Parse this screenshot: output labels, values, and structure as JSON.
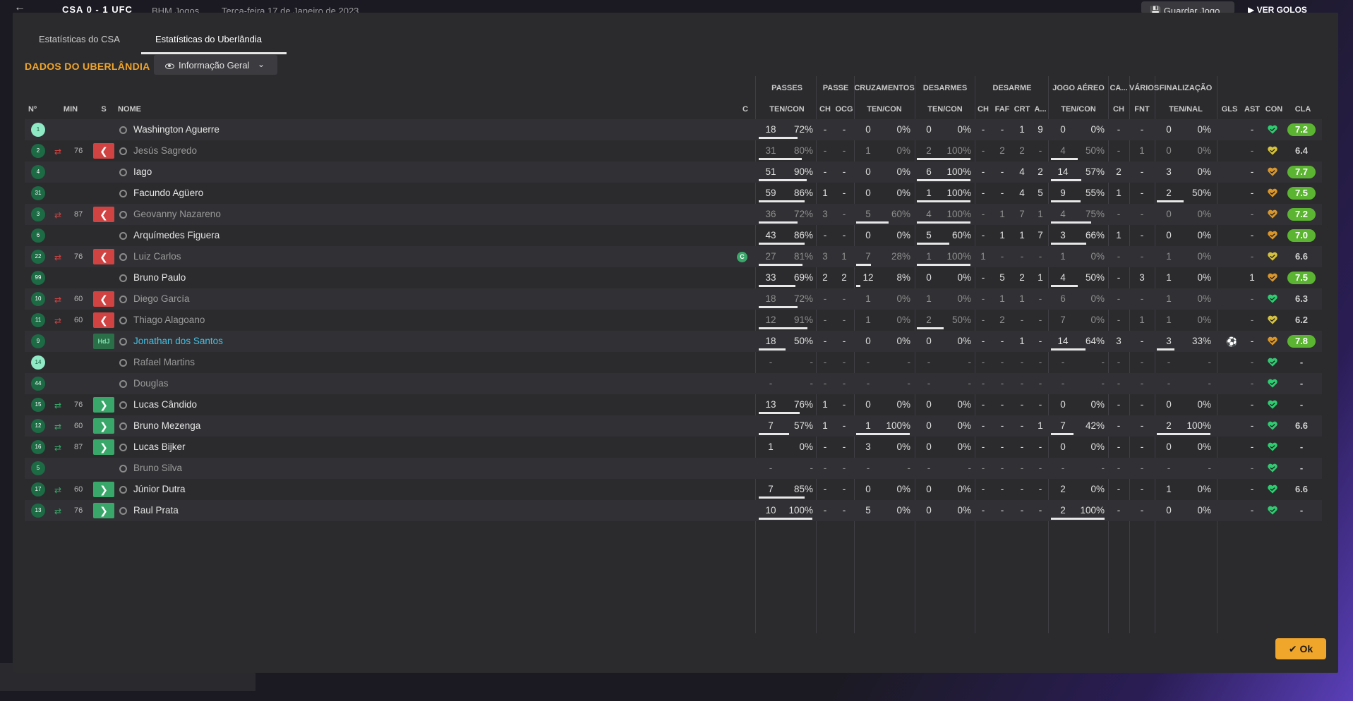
{
  "topbar": {
    "score": "CSA 0 - 1 UFC",
    "meta1": "BHM Jogos",
    "meta2": "Terça-feira 17 de Janeiro de 2023",
    "save": "Guardar Jogo",
    "goals": "VER GOLOS"
  },
  "tabs": {
    "csa": "Estatísticas do CSA",
    "uberlandia": "Estatísticas do Uberlândia"
  },
  "section_title": "DADOS DO UBERLÂNDIA",
  "dropdown": {
    "label": "Informação Geral"
  },
  "groups": {
    "passes": "PASSES",
    "passe": "PASSE",
    "cruzamentos": "CRUZAMENTOS",
    "desarmes": "DESARMES",
    "desarme": "DESARME",
    "jogo_aereo": "JOGO AÉREO",
    "ca": "CA...",
    "varios": "VÁRIOS",
    "finalizacao": "FINALIZAÇÃO"
  },
  "headers": {
    "num": "Nº",
    "min": "MIN",
    "s": "S",
    "nome": "NOME",
    "c": "C",
    "passes_tc": "TEN/CON",
    "passe_ch": "CH",
    "passe_ocg": "OCG",
    "cruz_tc": "TEN/CON",
    "des_tc": "TEN/CON",
    "d_ch": "CH",
    "d_faf": "FAF",
    "d_crt": "CRT",
    "d_a": "A...",
    "ja_tc": "TEN/CON",
    "ca_ch": "CH",
    "v_fnt": "FNT",
    "fin_tn": "TEN/NAL",
    "gls": "GLS",
    "ast": "AST",
    "con": "CON",
    "cla": "CLA"
  },
  "ok_label": "Ok",
  "players": [
    {
      "n": "1",
      "gk": true,
      "sub": "",
      "min": "",
      "s": "",
      "name": "Washington Aguerre",
      "style": "",
      "cap": "",
      "p": [
        "18",
        "72%",
        72
      ],
      "pch": "-",
      "pocg": "-",
      "cr": [
        "0",
        "0%",
        0
      ],
      "de": [
        "0",
        "0%",
        0
      ],
      "dch": "-",
      "dfaf": "-",
      "dcrt": "1",
      "da": "9",
      "ja": [
        "0",
        "0%",
        0
      ],
      "cach": "-",
      "vfnt": "-",
      "fin": [
        "0",
        "0%",
        0
      ],
      "gls": "",
      "ast": "-",
      "con": "green",
      "cla": "7.2",
      "claGood": true,
      "dim": false
    },
    {
      "n": "2",
      "gk": false,
      "sub": "out",
      "min": "76",
      "s": "out",
      "name": "Jesús Sagredo",
      "style": "muted",
      "cap": "",
      "p": [
        "31",
        "80%",
        80
      ],
      "pch": "-",
      "pocg": "-",
      "cr": [
        "1",
        "0%",
        0
      ],
      "de": [
        "2",
        "100%",
        100
      ],
      "dch": "-",
      "dfaf": "2",
      "dcrt": "2",
      "da": "-",
      "ja": [
        "4",
        "50%",
        50
      ],
      "cach": "-",
      "vfnt": "1",
      "fin": [
        "0",
        "0%",
        0
      ],
      "gls": "",
      "ast": "-",
      "con": "yellow",
      "cla": "6.4",
      "claGood": false,
      "dim": true
    },
    {
      "n": "4",
      "gk": false,
      "sub": "",
      "min": "",
      "s": "",
      "name": "Iago",
      "style": "",
      "cap": "",
      "p": [
        "51",
        "90%",
        90
      ],
      "pch": "-",
      "pocg": "-",
      "cr": [
        "0",
        "0%",
        0
      ],
      "de": [
        "6",
        "100%",
        100
      ],
      "dch": "-",
      "dfaf": "-",
      "dcrt": "4",
      "da": "2",
      "ja": [
        "14",
        "57%",
        57
      ],
      "cach": "2",
      "vfnt": "-",
      "fin": [
        "3",
        "0%",
        0
      ],
      "gls": "",
      "ast": "-",
      "con": "orange",
      "cla": "7.7",
      "claGood": true,
      "dim": false
    },
    {
      "n": "31",
      "gk": false,
      "sub": "",
      "min": "",
      "s": "",
      "name": "Facundo Agüero",
      "style": "",
      "cap": "",
      "p": [
        "59",
        "86%",
        86
      ],
      "pch": "1",
      "pocg": "-",
      "cr": [
        "0",
        "0%",
        0
      ],
      "de": [
        "1",
        "100%",
        100
      ],
      "dch": "-",
      "dfaf": "-",
      "dcrt": "4",
      "da": "5",
      "ja": [
        "9",
        "55%",
        55
      ],
      "cach": "1",
      "vfnt": "-",
      "fin": [
        "2",
        "50%",
        50
      ],
      "gls": "",
      "ast": "-",
      "con": "orange",
      "cla": "7.5",
      "claGood": true,
      "dim": false
    },
    {
      "n": "3",
      "gk": false,
      "sub": "out",
      "min": "87",
      "s": "out",
      "name": "Geovanny Nazareno",
      "style": "muted",
      "cap": "",
      "p": [
        "36",
        "72%",
        72
      ],
      "pch": "3",
      "pocg": "-",
      "cr": [
        "5",
        "60%",
        60
      ],
      "de": [
        "4",
        "100%",
        100
      ],
      "dch": "-",
      "dfaf": "1",
      "dcrt": "7",
      "da": "1",
      "ja": [
        "4",
        "75%",
        75
      ],
      "cach": "-",
      "vfnt": "-",
      "fin": [
        "0",
        "0%",
        0
      ],
      "gls": "",
      "ast": "-",
      "con": "orange",
      "cla": "7.2",
      "claGood": true,
      "dim": true
    },
    {
      "n": "6",
      "gk": false,
      "sub": "",
      "min": "",
      "s": "",
      "name": "Arquímedes Figuera",
      "style": "",
      "cap": "",
      "p": [
        "43",
        "86%",
        86
      ],
      "pch": "-",
      "pocg": "-",
      "cr": [
        "0",
        "0%",
        0
      ],
      "de": [
        "5",
        "60%",
        60
      ],
      "dch": "-",
      "dfaf": "1",
      "dcrt": "1",
      "da": "7",
      "ja": [
        "3",
        "66%",
        66
      ],
      "cach": "1",
      "vfnt": "-",
      "fin": [
        "0",
        "0%",
        0
      ],
      "gls": "",
      "ast": "-",
      "con": "orange",
      "cla": "7.0",
      "claGood": true,
      "dim": false
    },
    {
      "n": "22",
      "gk": false,
      "sub": "out",
      "min": "76",
      "s": "out",
      "name": "Luiz Carlos",
      "style": "muted",
      "cap": "C",
      "p": [
        "27",
        "81%",
        81
      ],
      "pch": "3",
      "pocg": "1",
      "cr": [
        "7",
        "28%",
        28
      ],
      "de": [
        "1",
        "100%",
        100
      ],
      "dch": "1",
      "dfaf": "-",
      "dcrt": "-",
      "da": "-",
      "ja": [
        "1",
        "0%",
        0
      ],
      "cach": "-",
      "vfnt": "-",
      "fin": [
        "1",
        "0%",
        0
      ],
      "gls": "",
      "ast": "-",
      "con": "yellow",
      "cla": "6.6",
      "claGood": false,
      "dim": true
    },
    {
      "n": "99",
      "gk": false,
      "sub": "",
      "min": "",
      "s": "",
      "name": "Bruno Paulo",
      "style": "",
      "cap": "",
      "p": [
        "33",
        "69%",
        69
      ],
      "pch": "2",
      "pocg": "2",
      "cr": [
        "12",
        "8%",
        8
      ],
      "de": [
        "0",
        "0%",
        0
      ],
      "dch": "-",
      "dfaf": "5",
      "dcrt": "2",
      "da": "1",
      "ja": [
        "4",
        "50%",
        50
      ],
      "cach": "-",
      "vfnt": "3",
      "fin": [
        "1",
        "0%",
        0
      ],
      "gls": "",
      "ast": "1",
      "con": "orange",
      "cla": "7.5",
      "claGood": true,
      "dim": false
    },
    {
      "n": "10",
      "gk": false,
      "sub": "out",
      "min": "60",
      "s": "out",
      "name": "Diego García",
      "style": "muted",
      "cap": "",
      "p": [
        "18",
        "72%",
        72
      ],
      "pch": "-",
      "pocg": "-",
      "cr": [
        "1",
        "0%",
        0
      ],
      "de": [
        "1",
        "0%",
        0
      ],
      "dch": "-",
      "dfaf": "1",
      "dcrt": "1",
      "da": "-",
      "ja": [
        "6",
        "0%",
        0
      ],
      "cach": "-",
      "vfnt": "-",
      "fin": [
        "1",
        "0%",
        0
      ],
      "gls": "",
      "ast": "-",
      "con": "green",
      "cla": "6.3",
      "claGood": false,
      "dim": true
    },
    {
      "n": "11",
      "gk": false,
      "sub": "out",
      "min": "60",
      "s": "out",
      "name": "Thiago Alagoano",
      "style": "muted",
      "cap": "",
      "p": [
        "12",
        "91%",
        91
      ],
      "pch": "-",
      "pocg": "-",
      "cr": [
        "1",
        "0%",
        0
      ],
      "de": [
        "2",
        "50%",
        50
      ],
      "dch": "-",
      "dfaf": "2",
      "dcrt": "-",
      "da": "-",
      "ja": [
        "7",
        "0%",
        0
      ],
      "cach": "-",
      "vfnt": "1",
      "fin": [
        "1",
        "0%",
        0
      ],
      "gls": "",
      "ast": "-",
      "con": "yellow",
      "cla": "6.2",
      "claGood": false,
      "dim": true
    },
    {
      "n": "9",
      "gk": false,
      "sub": "",
      "min": "",
      "s": "hdj",
      "name": "Jonathan dos Santos",
      "style": "link",
      "cap": "",
      "p": [
        "18",
        "50%",
        50
      ],
      "pch": "-",
      "pocg": "-",
      "cr": [
        "0",
        "0%",
        0
      ],
      "de": [
        "0",
        "0%",
        0
      ],
      "dch": "-",
      "dfaf": "-",
      "dcrt": "1",
      "da": "-",
      "ja": [
        "14",
        "64%",
        64
      ],
      "cach": "3",
      "vfnt": "-",
      "fin": [
        "3",
        "33%",
        33
      ],
      "gls": "ball",
      "ast": "-",
      "con": "orange",
      "cla": "7.8",
      "claGood": true,
      "dim": false
    },
    {
      "n": "14",
      "gk": true,
      "sub": "",
      "min": "",
      "s": "",
      "name": "Rafael Martins",
      "style": "muted",
      "cap": "",
      "p": [
        "-",
        "-",
        0
      ],
      "pch": "-",
      "pocg": "-",
      "cr": [
        "-",
        "-",
        0
      ],
      "de": [
        "-",
        "-",
        0
      ],
      "dch": "-",
      "dfaf": "-",
      "dcrt": "-",
      "da": "-",
      "ja": [
        "-",
        "-",
        0
      ],
      "cach": "-",
      "vfnt": "-",
      "fin": [
        "-",
        "-",
        0
      ],
      "gls": "",
      "ast": "-",
      "con": "green",
      "cla": "-",
      "claGood": false,
      "dim": true
    },
    {
      "n": "44",
      "gk": false,
      "sub": "",
      "min": "",
      "s": "",
      "name": "Douglas",
      "style": "muted",
      "cap": "",
      "p": [
        "-",
        "-",
        0
      ],
      "pch": "-",
      "pocg": "-",
      "cr": [
        "-",
        "-",
        0
      ],
      "de": [
        "-",
        "-",
        0
      ],
      "dch": "-",
      "dfaf": "-",
      "dcrt": "-",
      "da": "-",
      "ja": [
        "-",
        "-",
        0
      ],
      "cach": "-",
      "vfnt": "-",
      "fin": [
        "-",
        "-",
        0
      ],
      "gls": "",
      "ast": "-",
      "con": "green",
      "cla": "-",
      "claGood": false,
      "dim": true
    },
    {
      "n": "15",
      "gk": false,
      "sub": "in",
      "min": "76",
      "s": "in",
      "name": "Lucas Cândido",
      "style": "",
      "cap": "",
      "p": [
        "13",
        "76%",
        76
      ],
      "pch": "1",
      "pocg": "-",
      "cr": [
        "0",
        "0%",
        0
      ],
      "de": [
        "0",
        "0%",
        0
      ],
      "dch": "-",
      "dfaf": "-",
      "dcrt": "-",
      "da": "-",
      "ja": [
        "0",
        "0%",
        0
      ],
      "cach": "-",
      "vfnt": "-",
      "fin": [
        "0",
        "0%",
        0
      ],
      "gls": "",
      "ast": "-",
      "con": "green",
      "cla": "-",
      "claGood": false,
      "dim": false
    },
    {
      "n": "12",
      "gk": false,
      "sub": "in",
      "min": "60",
      "s": "in",
      "name": "Bruno Mezenga",
      "style": "",
      "cap": "",
      "p": [
        "7",
        "57%",
        57
      ],
      "pch": "1",
      "pocg": "-",
      "cr": [
        "1",
        "100%",
        100
      ],
      "de": [
        "0",
        "0%",
        0
      ],
      "dch": "-",
      "dfaf": "-",
      "dcrt": "-",
      "da": "1",
      "ja": [
        "7",
        "42%",
        42
      ],
      "cach": "-",
      "vfnt": "-",
      "fin": [
        "2",
        "100%",
        100
      ],
      "gls": "",
      "ast": "-",
      "con": "green",
      "cla": "6.6",
      "claGood": false,
      "dim": false
    },
    {
      "n": "16",
      "gk": false,
      "sub": "in",
      "min": "87",
      "s": "in",
      "name": "Lucas Bijker",
      "style": "",
      "cap": "",
      "p": [
        "1",
        "0%",
        0
      ],
      "pch": "-",
      "pocg": "-",
      "cr": [
        "3",
        "0%",
        0
      ],
      "de": [
        "0",
        "0%",
        0
      ],
      "dch": "-",
      "dfaf": "-",
      "dcrt": "-",
      "da": "-",
      "ja": [
        "0",
        "0%",
        0
      ],
      "cach": "-",
      "vfnt": "-",
      "fin": [
        "0",
        "0%",
        0
      ],
      "gls": "",
      "ast": "-",
      "con": "green",
      "cla": "-",
      "claGood": false,
      "dim": false
    },
    {
      "n": "5",
      "gk": false,
      "sub": "",
      "min": "",
      "s": "",
      "name": "Bruno Silva",
      "style": "muted",
      "cap": "",
      "p": [
        "-",
        "-",
        0
      ],
      "pch": "-",
      "pocg": "-",
      "cr": [
        "-",
        "-",
        0
      ],
      "de": [
        "-",
        "-",
        0
      ],
      "dch": "-",
      "dfaf": "-",
      "dcrt": "-",
      "da": "-",
      "ja": [
        "-",
        "-",
        0
      ],
      "cach": "-",
      "vfnt": "-",
      "fin": [
        "-",
        "-",
        0
      ],
      "gls": "",
      "ast": "-",
      "con": "green",
      "cla": "-",
      "claGood": false,
      "dim": true
    },
    {
      "n": "17",
      "gk": false,
      "sub": "in",
      "min": "60",
      "s": "in",
      "name": "Júnior Dutra",
      "style": "",
      "cap": "",
      "p": [
        "7",
        "85%",
        85
      ],
      "pch": "-",
      "pocg": "-",
      "cr": [
        "0",
        "0%",
        0
      ],
      "de": [
        "0",
        "0%",
        0
      ],
      "dch": "-",
      "dfaf": "-",
      "dcrt": "-",
      "da": "-",
      "ja": [
        "2",
        "0%",
        0
      ],
      "cach": "-",
      "vfnt": "-",
      "fin": [
        "1",
        "0%",
        0
      ],
      "gls": "",
      "ast": "-",
      "con": "green",
      "cla": "6.6",
      "claGood": false,
      "dim": false
    },
    {
      "n": "13",
      "gk": false,
      "sub": "in",
      "min": "76",
      "s": "in",
      "name": "Raul Prata",
      "style": "",
      "cap": "",
      "p": [
        "10",
        "100%",
        100
      ],
      "pch": "-",
      "pocg": "-",
      "cr": [
        "5",
        "0%",
        0
      ],
      "de": [
        "0",
        "0%",
        0
      ],
      "dch": "-",
      "dfaf": "-",
      "dcrt": "-",
      "da": "-",
      "ja": [
        "2",
        "100%",
        100
      ],
      "cach": "-",
      "vfnt": "-",
      "fin": [
        "0",
        "0%",
        0
      ],
      "gls": "",
      "ast": "-",
      "con": "green",
      "cla": "-",
      "claGood": false,
      "dim": false
    }
  ],
  "colors": {
    "accent": "#f0a52b",
    "sub_out": "#d14343",
    "sub_in": "#3aa76a",
    "rating_good": "#5cb532",
    "link": "#44c1e6",
    "heart_green": "#2ecc71",
    "heart_yellow": "#d6c23a",
    "heart_orange": "#d9962b"
  }
}
